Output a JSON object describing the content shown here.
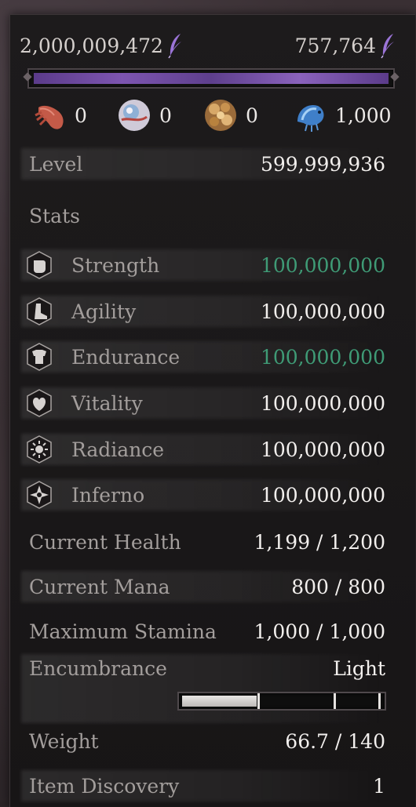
{
  "currencies": {
    "left": {
      "value": "2,000,009,472",
      "icon": "purple-feather-icon"
    },
    "right": {
      "value": "757,764",
      "icon": "purple-feather-icon"
    }
  },
  "resources": [
    {
      "icon": "hand-icon",
      "value": "0"
    },
    {
      "icon": "eye-orb-icon",
      "value": "0"
    },
    {
      "icon": "flower-icon",
      "value": "0"
    },
    {
      "icon": "blue-shrimp-icon",
      "value": "1,000"
    }
  ],
  "level": {
    "label": "Level",
    "value": "599,999,936"
  },
  "stats_title": "Stats",
  "stats": [
    {
      "name": "Strength",
      "value": "100,000,000",
      "icon": "fist-icon",
      "highlight": true
    },
    {
      "name": "Agility",
      "value": "100,000,000",
      "icon": "boot-icon",
      "highlight": false
    },
    {
      "name": "Endurance",
      "value": "100,000,000",
      "icon": "armor-icon",
      "highlight": true
    },
    {
      "name": "Vitality",
      "value": "100,000,000",
      "icon": "heart-icon",
      "highlight": false
    },
    {
      "name": "Radiance",
      "value": "100,000,000",
      "icon": "sun-icon",
      "highlight": false
    },
    {
      "name": "Inferno",
      "value": "100,000,000",
      "icon": "inferno-icon",
      "highlight": false
    }
  ],
  "attributes": [
    {
      "label": "Current Health",
      "value": "1,199 / 1,200"
    },
    {
      "label": "Current Mana",
      "value": "800 / 800"
    },
    {
      "label": "Maximum Stamina",
      "value": "1,000 / 1,000"
    }
  ],
  "encumbrance": {
    "label": "Encumbrance",
    "value": "Light",
    "level_fraction": 0.476
  },
  "weight": {
    "label": "Weight",
    "value": "66.7 / 140"
  },
  "item_discovery": {
    "label": "Item Discovery",
    "value": "1"
  },
  "colors": {
    "highlight": "#3f9b76",
    "label": "#a39e9c",
    "value": "#f2efed",
    "accent_purple": "#7d55b0"
  }
}
